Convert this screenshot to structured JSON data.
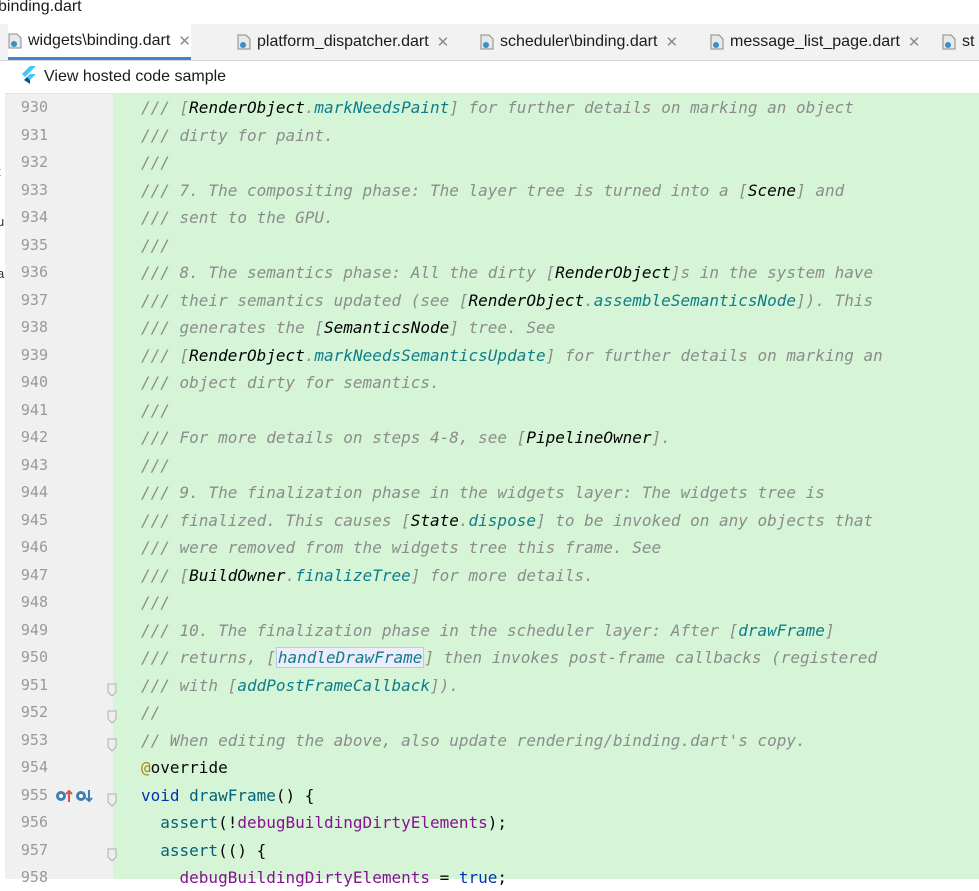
{
  "window": {
    "title": "binding.dart"
  },
  "tabs": [
    {
      "label": "widgets\\binding.dart",
      "active": true,
      "closable": true
    },
    {
      "label": "platform_dispatcher.dart",
      "active": false,
      "closable": true
    },
    {
      "label": "scheduler\\binding.dart",
      "active": false,
      "closable": true
    },
    {
      "label": "message_list_page.dart",
      "active": false,
      "closable": true
    },
    {
      "label": "st",
      "active": false,
      "closable": false
    }
  ],
  "sample_bar": {
    "label": "View hosted code sample",
    "icon": "flutter-icon"
  },
  "left_strip": [
    "t",
    "u",
    "a"
  ],
  "colors": {
    "code_bg": "#d6f5d6",
    "gutter_bg": "#f0f0f0",
    "tab_active_underline": "#4083c9",
    "comment": "#8c8c8c",
    "keyword": "#0033b3",
    "function": "#00627a",
    "field": "#871094",
    "annotation": "#9e880d"
  },
  "editor": {
    "lines": [
      {
        "n": "930",
        "segs": [
          [
            "c",
            "/// ["
          ],
          [
            "ref",
            "RenderObject"
          ],
          [
            "c",
            "."
          ],
          [
            "mem",
            "markNeedsPaint"
          ],
          [
            "c",
            "] for further details on marking an object"
          ]
        ]
      },
      {
        "n": "931",
        "segs": [
          [
            "c",
            "/// dirty for paint."
          ]
        ]
      },
      {
        "n": "932",
        "segs": [
          [
            "c",
            "///"
          ]
        ]
      },
      {
        "n": "933",
        "segs": [
          [
            "c",
            "/// 7. The compositing phase: The layer tree is turned into a ["
          ],
          [
            "ref",
            "Scene"
          ],
          [
            "c",
            "] and"
          ]
        ]
      },
      {
        "n": "934",
        "segs": [
          [
            "c",
            "/// sent to the GPU."
          ]
        ]
      },
      {
        "n": "935",
        "segs": [
          [
            "c",
            "///"
          ]
        ]
      },
      {
        "n": "936",
        "segs": [
          [
            "c",
            "/// 8. The semantics phase: All the dirty ["
          ],
          [
            "ref",
            "RenderObject"
          ],
          [
            "c",
            "]s in the system have"
          ]
        ]
      },
      {
        "n": "937",
        "segs": [
          [
            "c",
            "/// their semantics updated (see ["
          ],
          [
            "ref",
            "RenderObject"
          ],
          [
            "c",
            "."
          ],
          [
            "mem",
            "assembleSemanticsNode"
          ],
          [
            "c",
            "]). This"
          ]
        ]
      },
      {
        "n": "938",
        "segs": [
          [
            "c",
            "/// generates the ["
          ],
          [
            "ref",
            "SemanticsNode"
          ],
          [
            "c",
            "] tree. See"
          ]
        ]
      },
      {
        "n": "939",
        "segs": [
          [
            "c",
            "/// ["
          ],
          [
            "ref",
            "RenderObject"
          ],
          [
            "c",
            "."
          ],
          [
            "mem",
            "markNeedsSemanticsUpdate"
          ],
          [
            "c",
            "] for further details on marking an"
          ]
        ]
      },
      {
        "n": "940",
        "segs": [
          [
            "c",
            "/// object dirty for semantics."
          ]
        ]
      },
      {
        "n": "941",
        "segs": [
          [
            "c",
            "///"
          ]
        ]
      },
      {
        "n": "942",
        "segs": [
          [
            "c",
            "/// For more details on steps 4-8, see ["
          ],
          [
            "ref",
            "PipelineOwner"
          ],
          [
            "c",
            "]."
          ]
        ]
      },
      {
        "n": "943",
        "segs": [
          [
            "c",
            "///"
          ]
        ]
      },
      {
        "n": "944",
        "segs": [
          [
            "c",
            "/// 9. The finalization phase in the widgets layer: The widgets tree is"
          ]
        ]
      },
      {
        "n": "945",
        "segs": [
          [
            "c",
            "/// finalized. This causes ["
          ],
          [
            "ref",
            "State"
          ],
          [
            "c",
            "."
          ],
          [
            "mem",
            "dispose"
          ],
          [
            "c",
            "] to be invoked on any objects that"
          ]
        ]
      },
      {
        "n": "946",
        "segs": [
          [
            "c",
            "/// were removed from the widgets tree this frame. See"
          ]
        ]
      },
      {
        "n": "947",
        "segs": [
          [
            "c",
            "/// ["
          ],
          [
            "ref",
            "BuildOwner"
          ],
          [
            "c",
            "."
          ],
          [
            "mem",
            "finalizeTree"
          ],
          [
            "c",
            "] for more details."
          ]
        ]
      },
      {
        "n": "948",
        "segs": [
          [
            "c",
            "///"
          ]
        ]
      },
      {
        "n": "949",
        "segs": [
          [
            "c",
            "/// 10. The finalization phase in the scheduler layer: After ["
          ],
          [
            "mem",
            "drawFrame"
          ],
          [
            "c",
            "]"
          ]
        ]
      },
      {
        "n": "950",
        "segs": [
          [
            "c",
            "/// returns, ["
          ],
          [
            "memboxed",
            "handleDrawFrame"
          ],
          [
            "c",
            "] then invokes post-frame callbacks (registered"
          ]
        ]
      },
      {
        "n": "951",
        "segs": [
          [
            "c",
            "/// with ["
          ],
          [
            "mem",
            "addPostFrameCallback"
          ],
          [
            "c",
            "])."
          ]
        ]
      },
      {
        "n": "952",
        "segs": [
          [
            "c",
            "//"
          ]
        ]
      },
      {
        "n": "953",
        "segs": [
          [
            "c",
            "// When editing the above, also update rendering/binding.dart's copy."
          ]
        ]
      },
      {
        "n": "954",
        "segs": [
          [
            "ann",
            "@"
          ],
          [
            "plain",
            "override"
          ]
        ]
      },
      {
        "n": "955",
        "segs": [
          [
            "kw",
            "void "
          ],
          [
            "fn",
            "drawFrame"
          ],
          [
            "plain",
            "() {"
          ]
        ]
      },
      {
        "n": "956",
        "segs": [
          [
            "plain",
            "  "
          ],
          [
            "fn",
            "assert"
          ],
          [
            "plain",
            "(!"
          ],
          [
            "fld",
            "debugBuildingDirtyElements"
          ],
          [
            "plain",
            ");"
          ]
        ]
      },
      {
        "n": "957",
        "segs": [
          [
            "plain",
            "  "
          ],
          [
            "fn",
            "assert"
          ],
          [
            "plain",
            "(() {"
          ]
        ]
      },
      {
        "n": "958",
        "segs": [
          [
            "plain",
            "    "
          ],
          [
            "fld",
            "debugBuildingDirtyElements"
          ],
          [
            "plain",
            " = "
          ],
          [
            "kw",
            "true"
          ],
          [
            "plain",
            ";"
          ]
        ]
      }
    ]
  }
}
